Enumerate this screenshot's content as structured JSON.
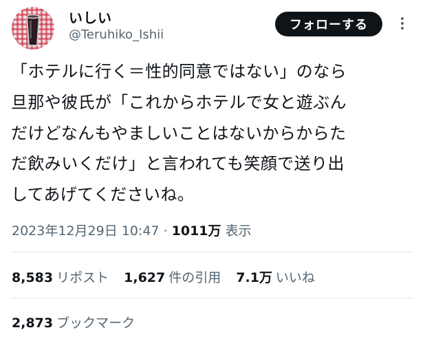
{
  "user": {
    "display_name": "いしい",
    "handle": "@Teruhiko_Ishii",
    "avatar_icon": "avatar-cup-photo"
  },
  "follow_button_label": "フォローする",
  "more_icon": "more-vertical-icon",
  "tweet": {
    "lines": [
      "「ホテルに行く＝性的同意ではない」のなら",
      "旦那や彼氏が「これからホテルで女と遊ぶん",
      "だけどなんもやましいことはないからからた",
      "だ飲みいくだけ」と言われても笑顔で送り出",
      "してあげてくださいね。"
    ]
  },
  "meta": {
    "timestamp": "2023年12月29日 10:47",
    "separator": " · ",
    "views_count": "1011万",
    "views_label": " 表示"
  },
  "stats": {
    "reposts": {
      "count": "8,583",
      "label": "リポスト"
    },
    "quotes": {
      "count": "1,627",
      "label": "件の引用"
    },
    "likes": {
      "count": "7.1万",
      "label": "いいね"
    }
  },
  "bookmarks": {
    "count": "2,873",
    "label": "ブックマーク"
  },
  "colors": {
    "text_primary": "#0f1419",
    "text_secondary": "#536471",
    "button_bg": "#0f1419",
    "divider": "#e3e7ea"
  }
}
